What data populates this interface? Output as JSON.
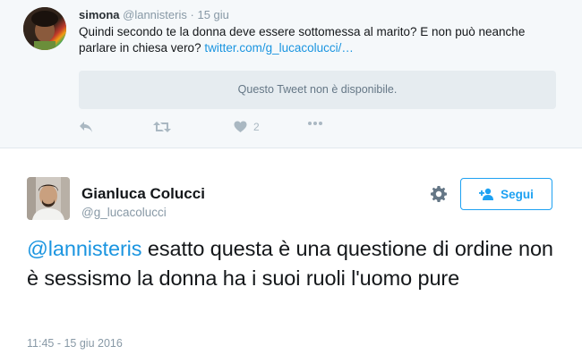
{
  "parent_tweet": {
    "author_name": "simona",
    "handle": "@lannisteris",
    "separator": "·",
    "date": "15 giu",
    "text": "Quindi secondo te la donna deve essere sottomessa al marito? E non può neanche parlare in chiesa vero?",
    "link": "twitter.com/g_lucacolucci/…",
    "unavailable_notice": "Questo Tweet non è disponibile.",
    "like_count": "2"
  },
  "main_tweet": {
    "author_name": "Gianluca Colucci",
    "handle": "@g_lucacolucci",
    "follow_label": "Segui",
    "mention": "@lannisteris",
    "text": " esatto questa è una questione di ordine non è sessismo la donna ha i suoi ruoli l'uomo pure",
    "timestamp": "11:45 - 15 giu 2016"
  },
  "colors": {
    "accent": "#1da1f2",
    "link": "#1b95e0",
    "muted": "#8899a6",
    "parent_bg": "#f5f8fa"
  },
  "icons": [
    "reply-icon",
    "retweet-icon",
    "heart-icon",
    "more-icon",
    "gear-icon",
    "follow-person-icon"
  ]
}
